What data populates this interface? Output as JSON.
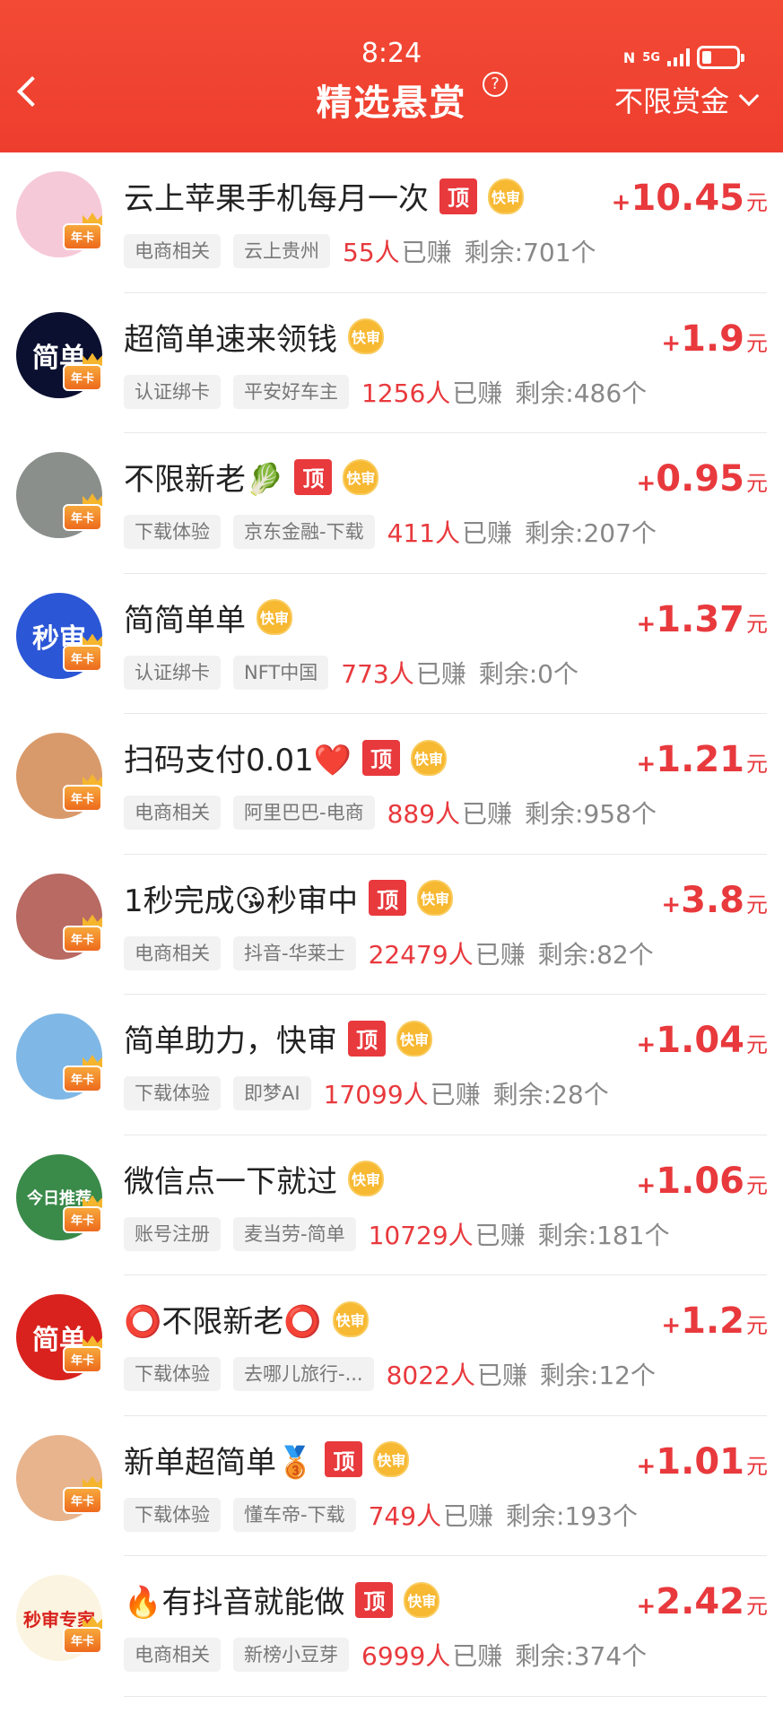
{
  "status_bar": {
    "time": "8:24",
    "network": "5G"
  },
  "header": {
    "title": "精选悬赏",
    "help_symbol": "?",
    "filter_label": "不限赏金"
  },
  "colors": {
    "header_bg": "#ee3d2e",
    "price": "#e8393d",
    "top_badge": "#e8393d",
    "fast_badge": "#f7b832"
  },
  "labels": {
    "top_badge": "顶",
    "fast_badge": "快审",
    "year_card": "年卡",
    "plus": "+",
    "yuan": "元",
    "earned_suffix": "已赚",
    "remain_prefix": "剩余:",
    "remain_suffix": "个"
  },
  "tasks": [
    {
      "title": "云上苹果手机每月一次",
      "top": true,
      "fast": true,
      "price": "10.45",
      "tag1": "电商相关",
      "tag2": "云上贵州",
      "earned": "55人",
      "remain": "701",
      "avatar_text": "",
      "avatar_color": "#f6c9d8"
    },
    {
      "title": "超简单速来领钱",
      "top": false,
      "fast": true,
      "price": "1.9",
      "tag1": "认证绑卡",
      "tag2": "平安好车主",
      "earned": "1256人",
      "remain": "486",
      "avatar_text": "简单",
      "avatar_color": "#0b1030"
    },
    {
      "title": "不限新老🥬",
      "top": true,
      "fast": true,
      "price": "0.95",
      "tag1": "下载体验",
      "tag2": "京东金融-下载",
      "earned": "411人",
      "remain": "207",
      "avatar_text": "",
      "avatar_color": "#8a8f8c"
    },
    {
      "title": "简简单单",
      "top": false,
      "fast": true,
      "price": "1.37",
      "tag1": "认证绑卡",
      "tag2": "NFT中国",
      "earned": "773人",
      "remain": "0",
      "avatar_text": "秒审",
      "avatar_color": "#2b56d6"
    },
    {
      "title": "扫码支付0.01❤️",
      "top": true,
      "fast": true,
      "price": "1.21",
      "tag1": "电商相关",
      "tag2": "阿里巴巴-电商",
      "earned": "889人",
      "remain": "958",
      "avatar_text": "",
      "avatar_color": "#d99a6b"
    },
    {
      "title": "1秒完成😘秒审中",
      "top": true,
      "fast": true,
      "price": "3.8",
      "tag1": "电商相关",
      "tag2": "抖音-华莱士",
      "earned": "22479人",
      "remain": "82",
      "avatar_text": "",
      "avatar_color": "#b86a63"
    },
    {
      "title": "简单助力，快审",
      "top": true,
      "fast": true,
      "price": "1.04",
      "tag1": "下载体验",
      "tag2": "即梦AI",
      "earned": "17099人",
      "remain": "28",
      "avatar_text": "",
      "avatar_color": "#7fb8e6"
    },
    {
      "title": "微信点一下就过",
      "top": false,
      "fast": true,
      "price": "1.06",
      "tag1": "账号注册",
      "tag2": "麦当劳-简单",
      "earned": "10729人",
      "remain": "181",
      "avatar_text": "今日推荐",
      "avatar_color": "#3a8a4a"
    },
    {
      "title": "⭕不限新老⭕",
      "top": false,
      "fast": true,
      "price": "1.2",
      "tag1": "下载体验",
      "tag2": "去哪儿旅行-...",
      "earned": "8022人",
      "remain": "12",
      "avatar_text": "简单",
      "avatar_color": "#d9221d"
    },
    {
      "title": "新单超简单🥉",
      "top": true,
      "fast": true,
      "price": "1.01",
      "tag1": "下载体验",
      "tag2": "懂车帝-下载",
      "earned": "749人",
      "remain": "193",
      "avatar_text": "",
      "avatar_color": "#e8b48d"
    },
    {
      "title": "🔥有抖音就能做",
      "top": true,
      "fast": true,
      "price": "2.42",
      "tag1": "电商相关",
      "tag2": "新榜小豆芽",
      "earned": "6999人",
      "remain": "374",
      "avatar_text": "秒审专家",
      "avatar_color": "#fbf4e0"
    }
  ]
}
